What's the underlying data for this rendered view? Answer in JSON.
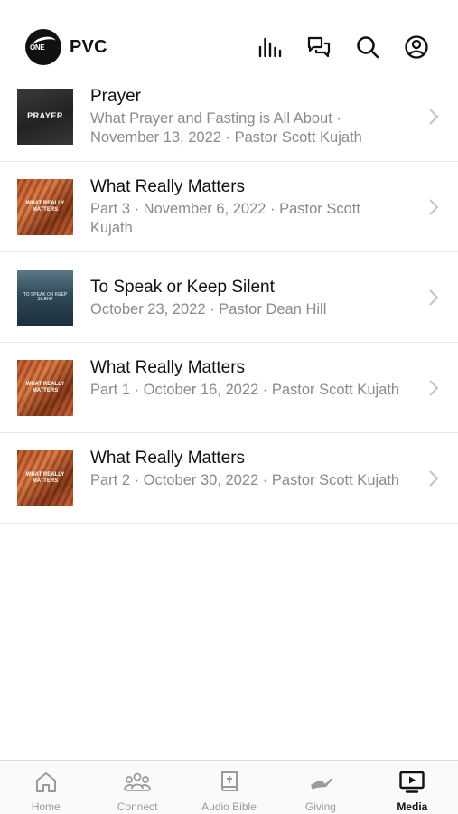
{
  "header": {
    "app_name": "PVC",
    "logo_text": "ONE",
    "icons": [
      "equalizer-icon",
      "chat-icon",
      "search-icon",
      "profile-icon"
    ]
  },
  "media_items": [
    {
      "title": "Prayer",
      "subtitle": "What Prayer and Fasting is All About · November 13, 2022 · Pastor Scott Kujath",
      "thumb_text": "PRAYER"
    },
    {
      "title": "What Really Matters",
      "subtitle": "Part 3 · November 6, 2022 · Pastor Scott Kujath",
      "thumb_text": "WHAT REALLY MATTERS"
    },
    {
      "title": "To Speak or Keep Silent",
      "subtitle": "October 23, 2022 · Pastor Dean Hill",
      "thumb_text": "TO SPEAK OR KEEP SILENT"
    },
    {
      "title": "What Really Matters",
      "subtitle": "Part 1 · October 16, 2022 · Pastor Scott Kujath",
      "thumb_text": "WHAT REALLY MATTERS"
    },
    {
      "title": "What Really Matters",
      "subtitle": "Part 2 · October 30, 2022 · Pastor Scott Kujath",
      "thumb_text": "WHAT REALLY MATTERS"
    }
  ],
  "tabbar": {
    "tabs": [
      {
        "label": "Home",
        "icon": "home-icon",
        "active": false
      },
      {
        "label": "Connect",
        "icon": "people-icon",
        "active": false
      },
      {
        "label": "Audio Bible",
        "icon": "bible-icon",
        "active": false
      },
      {
        "label": "Giving",
        "icon": "giving-hand-icon",
        "active": false
      },
      {
        "label": "Media",
        "icon": "media-play-icon",
        "active": true
      }
    ]
  },
  "colors": {
    "text_primary": "#111111",
    "text_secondary": "#8a8a8a",
    "tab_inactive": "#9a9a9a",
    "divider": "#e6e6e6"
  }
}
